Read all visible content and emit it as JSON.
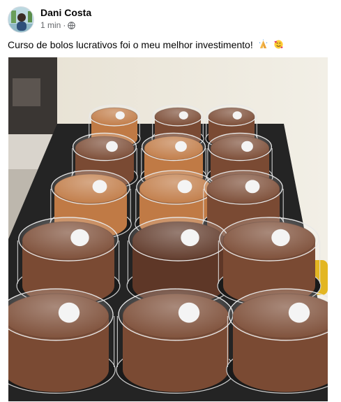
{
  "post": {
    "author_name": "Dani Costa",
    "timestamp": "1 min",
    "separator": "·",
    "privacy_icon": "globe-icon",
    "caption": "Curso de bolos lucrativos foi o meu melhor investimento!",
    "caption_emojis": [
      "folded-hands-emoji",
      "smiling-face-with-hearts-emoji"
    ],
    "photo": {
      "subject": "cakes-in-plastic-containers",
      "cake_colors": {
        "chocolate": "#7a4a33",
        "caramel": "#c07a45",
        "dark_chocolate": "#5e3727"
      }
    }
  }
}
